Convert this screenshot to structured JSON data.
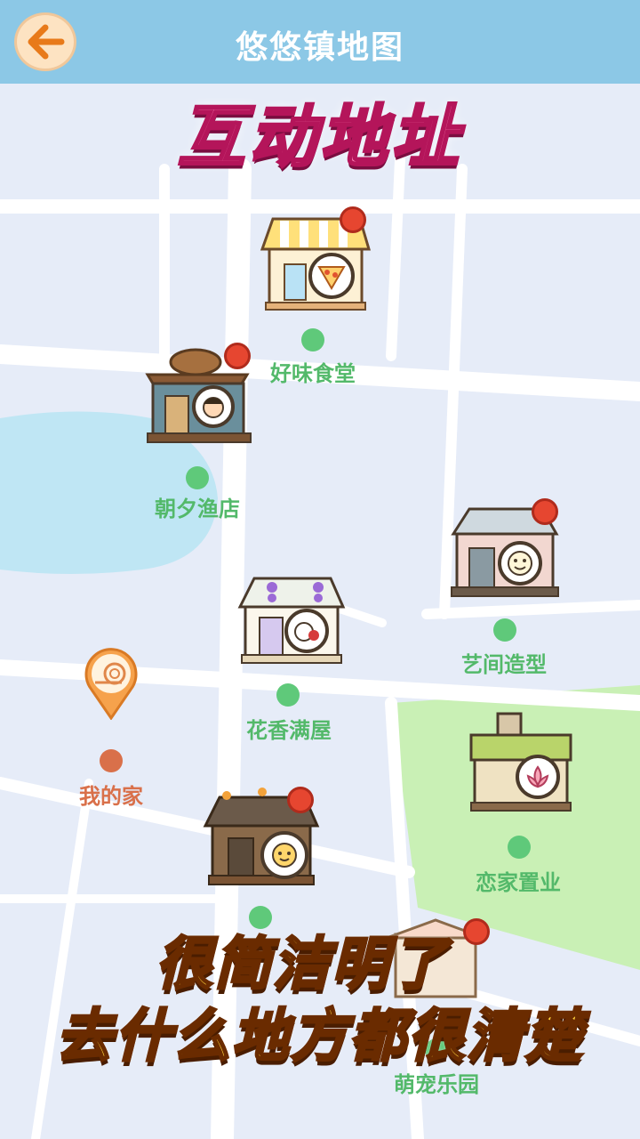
{
  "header": {
    "title": "悠悠镇地图",
    "back_icon": "arrow-left-icon"
  },
  "banner": {
    "text": "互动地址"
  },
  "locations": [
    {
      "name": "好味食堂",
      "icon": "pizza-icon"
    },
    {
      "name": "朝夕渔店",
      "icon": "fisherman-avatar-icon"
    },
    {
      "name": "艺间造型",
      "icon": "smiley-icon"
    },
    {
      "name": "花香满屋",
      "icon": "cat-rose-icon"
    },
    {
      "name": "我的家",
      "icon": "snail-pin-icon"
    },
    {
      "name": "恋家置业",
      "icon": "lotus-icon"
    },
    {
      "name": "萌宠乐园",
      "icon": "pet-park-icon"
    }
  ],
  "caption": {
    "line1": "很简洁明了",
    "line2": "去什么地方都很清楚"
  },
  "colors": {
    "header": "#8cc8e6",
    "label_green": "#53b96a",
    "home_label": "#d9704a",
    "water": "#bfe6f4",
    "park": "#c9f0b5"
  }
}
